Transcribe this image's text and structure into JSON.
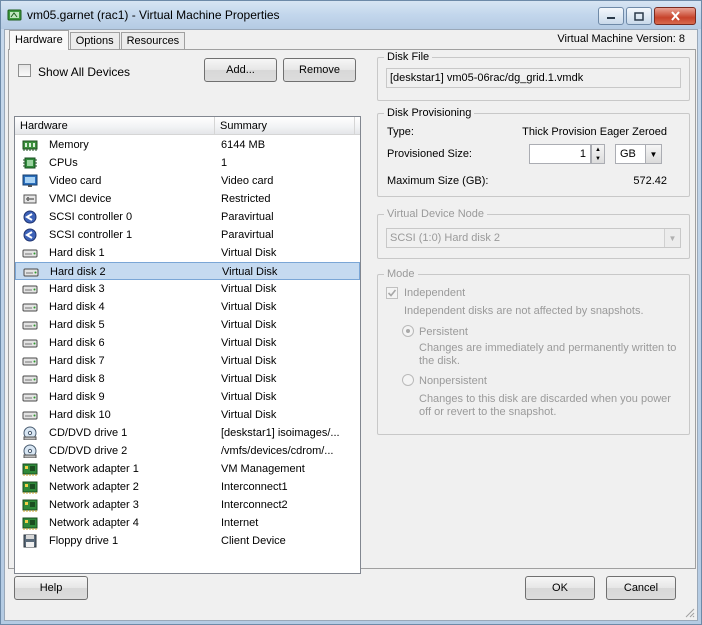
{
  "window": {
    "title": "vm05.garnet (rac1) - Virtual Machine Properties"
  },
  "tabs": [
    {
      "label": "Hardware",
      "active": true
    },
    {
      "label": "Options",
      "active": false
    },
    {
      "label": "Resources",
      "active": false
    }
  ],
  "vm_version": "Virtual Machine Version: 8",
  "hardware_panel": {
    "show_all_devices_label": "Show All Devices",
    "show_all_devices_checked": false,
    "add_label": "Add...",
    "remove_label": "Remove",
    "columns": {
      "hardware": "Hardware",
      "summary": "Summary"
    },
    "rows": [
      {
        "icon": "memory-icon",
        "name": "Memory",
        "summary": "6144 MB"
      },
      {
        "icon": "cpu-icon",
        "name": "CPUs",
        "summary": "1"
      },
      {
        "icon": "monitor-icon",
        "name": "Video card",
        "summary": "Video card"
      },
      {
        "icon": "vmci-icon",
        "name": "VMCI device",
        "summary": "Restricted"
      },
      {
        "icon": "scsi-controller-icon",
        "name": "SCSI controller 0",
        "summary": "Paravirtual"
      },
      {
        "icon": "scsi-controller-icon",
        "name": "SCSI controller 1",
        "summary": "Paravirtual"
      },
      {
        "icon": "hard-disk-icon",
        "name": "Hard disk 1",
        "summary": "Virtual Disk"
      },
      {
        "icon": "hard-disk-icon",
        "name": "Hard disk 2",
        "summary": "Virtual Disk",
        "selected": true
      },
      {
        "icon": "hard-disk-icon",
        "name": "Hard disk 3",
        "summary": "Virtual Disk"
      },
      {
        "icon": "hard-disk-icon",
        "name": "Hard disk 4",
        "summary": "Virtual Disk"
      },
      {
        "icon": "hard-disk-icon",
        "name": "Hard disk 5",
        "summary": "Virtual Disk"
      },
      {
        "icon": "hard-disk-icon",
        "name": "Hard disk 6",
        "summary": "Virtual Disk"
      },
      {
        "icon": "hard-disk-icon",
        "name": "Hard disk 7",
        "summary": "Virtual Disk"
      },
      {
        "icon": "hard-disk-icon",
        "name": "Hard disk 8",
        "summary": "Virtual Disk"
      },
      {
        "icon": "hard-disk-icon",
        "name": "Hard disk 9",
        "summary": "Virtual Disk"
      },
      {
        "icon": "hard-disk-icon",
        "name": "Hard disk 10",
        "summary": "Virtual Disk"
      },
      {
        "icon": "cd-dvd-icon",
        "name": "CD/DVD drive 1",
        "summary": "[deskstar1] isoimages/..."
      },
      {
        "icon": "cd-dvd-icon",
        "name": "CD/DVD drive 2",
        "summary": "/vmfs/devices/cdrom/..."
      },
      {
        "icon": "network-adapter-icon",
        "name": "Network adapter 1",
        "summary": "VM Management"
      },
      {
        "icon": "network-adapter-icon",
        "name": "Network adapter 2",
        "summary": "Interconnect1"
      },
      {
        "icon": "network-adapter-icon",
        "name": "Network adapter 3",
        "summary": "Interconnect2"
      },
      {
        "icon": "network-adapter-icon",
        "name": "Network adapter 4",
        "summary": "Internet"
      },
      {
        "icon": "floppy-icon",
        "name": "Floppy drive 1",
        "summary": "Client Device"
      }
    ]
  },
  "disk_file": {
    "title": "Disk File",
    "value": "[deskstar1] vm05-06rac/dg_grid.1.vmdk"
  },
  "disk_provisioning": {
    "title": "Disk Provisioning",
    "type_label": "Type:",
    "type_value": "Thick Provision Eager Zeroed",
    "provisioned_size_label": "Provisioned Size:",
    "provisioned_size_value": "1",
    "unit": "GB",
    "max_size_label": "Maximum Size (GB):",
    "max_size_value": "572.42"
  },
  "virtual_device_node": {
    "title": "Virtual Device Node",
    "value": "SCSI (1:0) Hard disk 2"
  },
  "mode": {
    "title": "Mode",
    "independent_label": "Independent",
    "independent_checked": true,
    "independent_desc": "Independent disks are not affected by snapshots.",
    "persistent_label": "Persistent",
    "persistent_selected": true,
    "persistent_desc_1": "Changes are immediately and permanently written to",
    "persistent_desc_2": "the disk.",
    "nonpersistent_label": "Nonpersistent",
    "nonpersistent_desc_1": "Changes to this disk are discarded when you power",
    "nonpersistent_desc_2": "off or revert to the snapshot."
  },
  "footer": {
    "help_label": "Help",
    "ok_label": "OK",
    "cancel_label": "Cancel"
  }
}
